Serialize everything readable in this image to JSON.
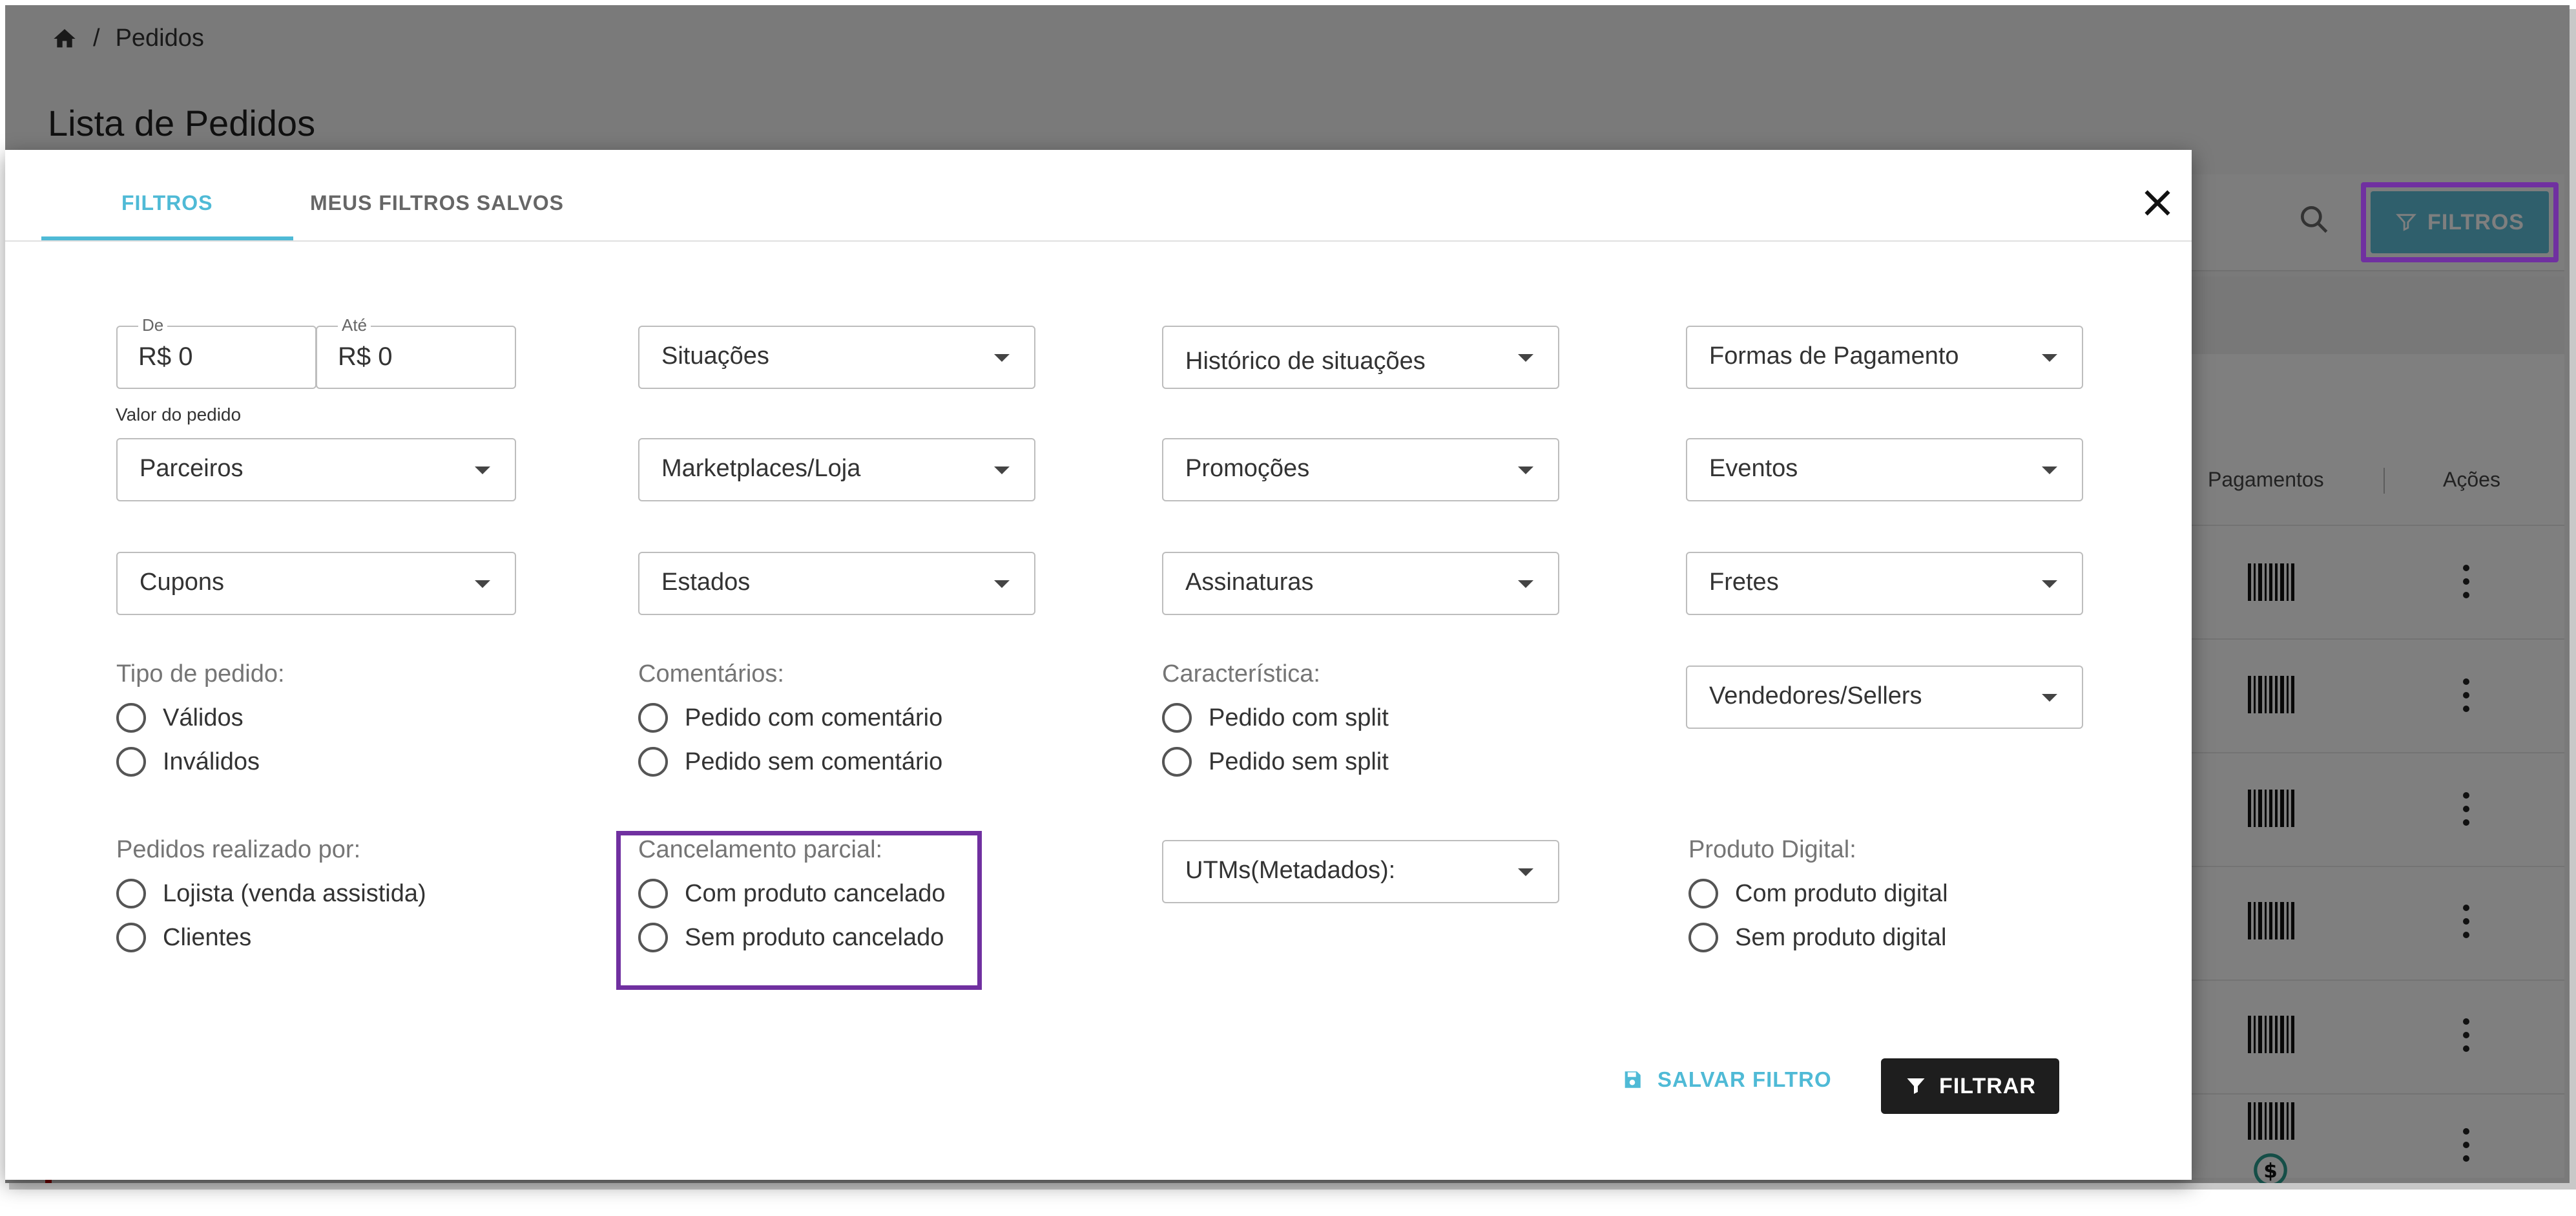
{
  "breadcrumb": {
    "current": "Pedidos",
    "separator": "/"
  },
  "page": {
    "title": "Lista de Pedidos"
  },
  "toolbar": {
    "filter_button": "FILTROS"
  },
  "table": {
    "columns": {
      "pagamentos": "Pagamentos",
      "acoes": "Ações"
    },
    "row_count": 6
  },
  "modal": {
    "tabs": [
      {
        "label": "FILTROS",
        "active": true
      },
      {
        "label": "MEUS FILTROS SALVOS",
        "active": false
      }
    ],
    "valor": {
      "de_label": "De",
      "de_value": "R$ 0",
      "ate_label": "Até",
      "ate_value": "R$ 0",
      "hint": "Valor do pedido"
    },
    "selects": {
      "situacoes": "Situações",
      "historico": "Histórico de situações",
      "formas_pagamento": "Formas de Pagamento",
      "parceiros": "Parceiros",
      "marketplaces": "Marketplaces/Loja",
      "promocoes": "Promoções",
      "eventos": "Eventos",
      "cupons": "Cupons",
      "estados": "Estados",
      "assinaturas": "Assinaturas",
      "fretes": "Fretes",
      "vendedores": "Vendedores/Sellers",
      "utms": "UTMs(Metadados):"
    },
    "tipo_pedido": {
      "title": "Tipo de pedido:",
      "options": [
        "Válidos",
        "Inválidos"
      ]
    },
    "comentarios": {
      "title": "Comentários:",
      "options": [
        "Pedido com comentário",
        "Pedido sem comentário"
      ]
    },
    "caracteristica": {
      "title": "Característica:",
      "options": [
        "Pedido com split",
        "Pedido sem split"
      ]
    },
    "realizado_por": {
      "title": "Pedidos realizado por:",
      "options": [
        "Lojista (venda assistida)",
        "Clientes"
      ]
    },
    "cancelamento": {
      "title": "Cancelamento parcial:",
      "options": [
        "Com produto cancelado",
        "Sem produto cancelado"
      ]
    },
    "produto_digital": {
      "title": "Produto Digital:",
      "options": [
        "Com produto digital",
        "Sem produto digital"
      ]
    },
    "actions": {
      "save": "SALVAR FILTRO",
      "filter": "FILTRAR"
    }
  },
  "colors": {
    "accent": "#4fbad6",
    "highlight": "#7030a0",
    "primary_button": "#1e1e1e"
  }
}
